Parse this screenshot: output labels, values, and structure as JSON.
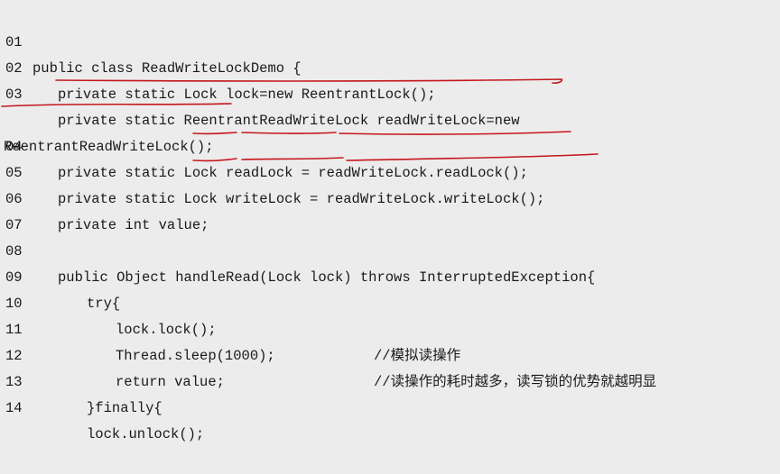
{
  "code": {
    "lines": [
      {
        "no": "01",
        "text": "public class ReadWriteLockDemo {",
        "comment": ""
      },
      {
        "no": "02",
        "text": "private static Lock lock=new ReentrantLock();",
        "comment": ""
      },
      {
        "no": "03",
        "text": "private static ReentrantReadWriteLock readWriteLock=new",
        "comment": ""
      },
      {
        "no": "",
        "text": "ReentrantReadWriteLock();",
        "comment": ""
      },
      {
        "no": "04",
        "text": "private static Lock readLock = readWriteLock.readLock();",
        "comment": ""
      },
      {
        "no": "05",
        "text": "private static Lock writeLock = readWriteLock.writeLock();",
        "comment": ""
      },
      {
        "no": "06",
        "text": "private int value;",
        "comment": ""
      },
      {
        "no": "07",
        "text": "",
        "comment": ""
      },
      {
        "no": "08",
        "text": "public Object handleRead(Lock lock) throws InterruptedException{",
        "comment": ""
      },
      {
        "no": "09",
        "text": "try{",
        "comment": ""
      },
      {
        "no": "10",
        "text": "lock.lock();",
        "comment": "//模拟读操作"
      },
      {
        "no": "11",
        "text": "Thread.sleep(1000);",
        "comment": "//读操作的耗时越多，读写锁的优势就越明显"
      },
      {
        "no": "12",
        "text": "return value;",
        "comment": ""
      },
      {
        "no": "13",
        "text": "}finally{",
        "comment": ""
      },
      {
        "no": "14",
        "text": "lock.unlock();",
        "comment": ""
      }
    ]
  },
  "annotation_color": "#c4161c"
}
